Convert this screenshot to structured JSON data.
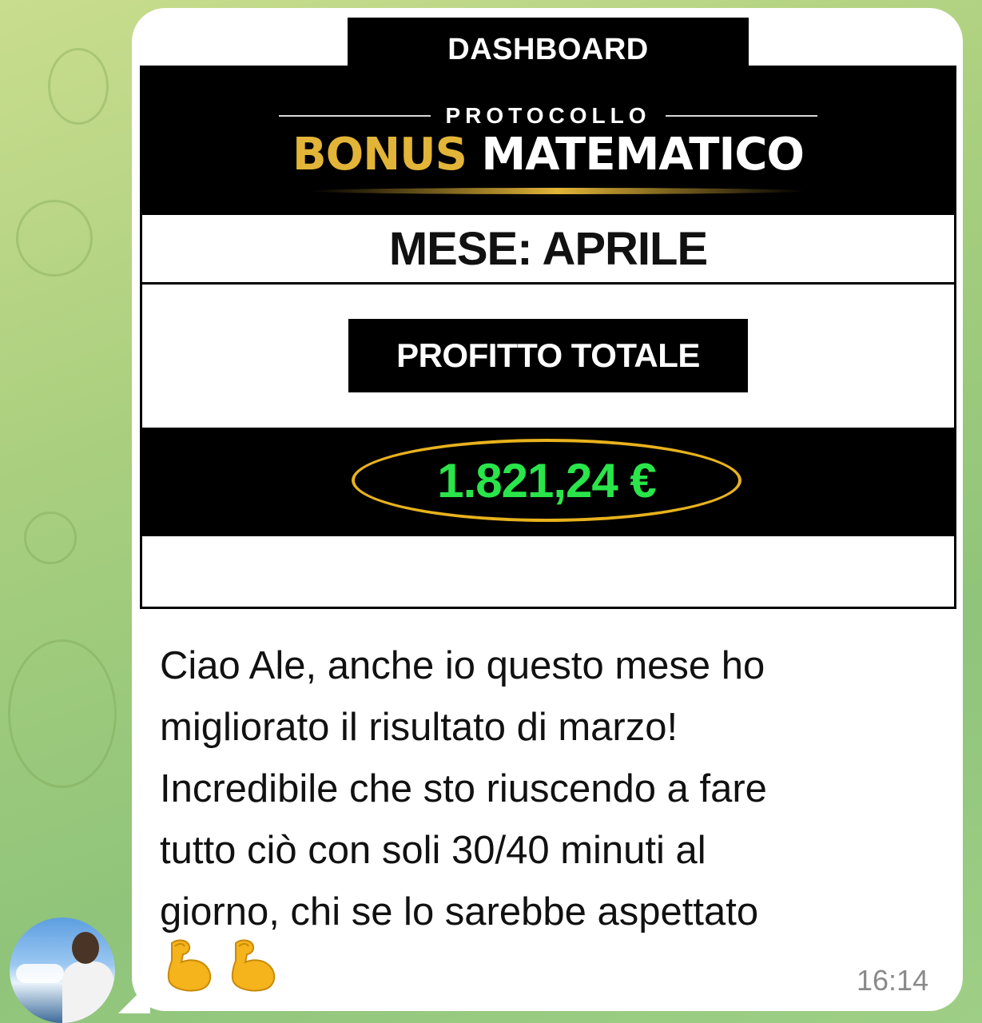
{
  "dashboard": {
    "tab_label": "DASHBOARD",
    "logo_top": "PROTOCOLLO",
    "logo_gold": "BONUS",
    "logo_white": "MATEMATICO",
    "month_label": "MESE: APRILE",
    "profit_label": "PROFITTO TOTALE",
    "profit_value": "1.821,24 €"
  },
  "message": {
    "lines": [
      "Ciao Ale, anche io questo mese ho",
      "migliorato il risultato di marzo!",
      "Incredibile che sto riuscendo a fare",
      "tutto ciò con soli 30/40 minuti al",
      "giorno, chi se lo sarebbe aspettato"
    ],
    "emojis": [
      "flexed-biceps",
      "flexed-biceps"
    ],
    "timestamp": "16:14"
  },
  "colors": {
    "gold": "#e2b437",
    "profit_green": "#29e54a",
    "oval_yellow": "#e8b21d",
    "chat_bg": "#a9cf7e"
  }
}
